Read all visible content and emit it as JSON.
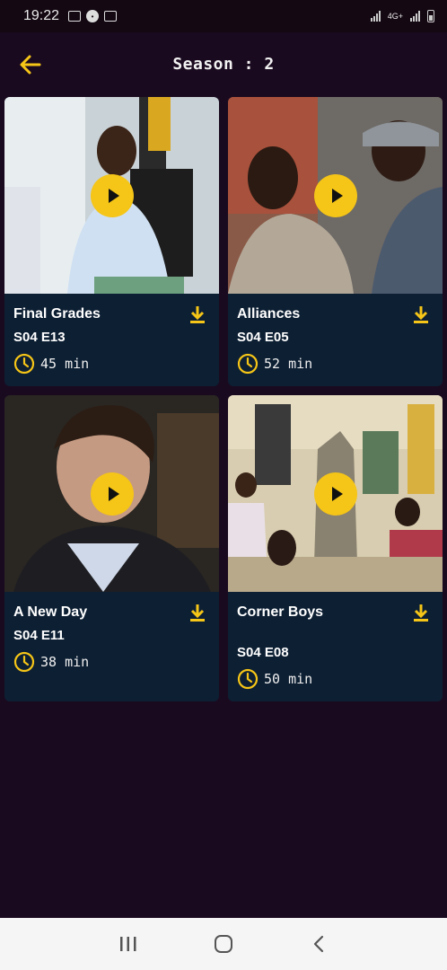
{
  "status_bar": {
    "time": "19:22",
    "network": "4G+"
  },
  "header": {
    "title": "Season : 2"
  },
  "colors": {
    "accent": "#f5c517",
    "card_bg": "#0d1f33",
    "page_bg": "#1a0a1f"
  },
  "episodes": [
    {
      "title": "Final Grades",
      "code": "S04 E13",
      "duration": "45 min"
    },
    {
      "title": "Alliances",
      "code": "S04 E05",
      "duration": "52 min"
    },
    {
      "title": "A New Day",
      "code": "S04 E11",
      "duration": "38 min"
    },
    {
      "title": "Corner Boys",
      "code": "S04 E08",
      "duration": "50 min"
    }
  ],
  "icons": {
    "back": "arrow-left-icon",
    "play": "play-icon",
    "download": "download-icon",
    "clock": "clock-icon"
  }
}
